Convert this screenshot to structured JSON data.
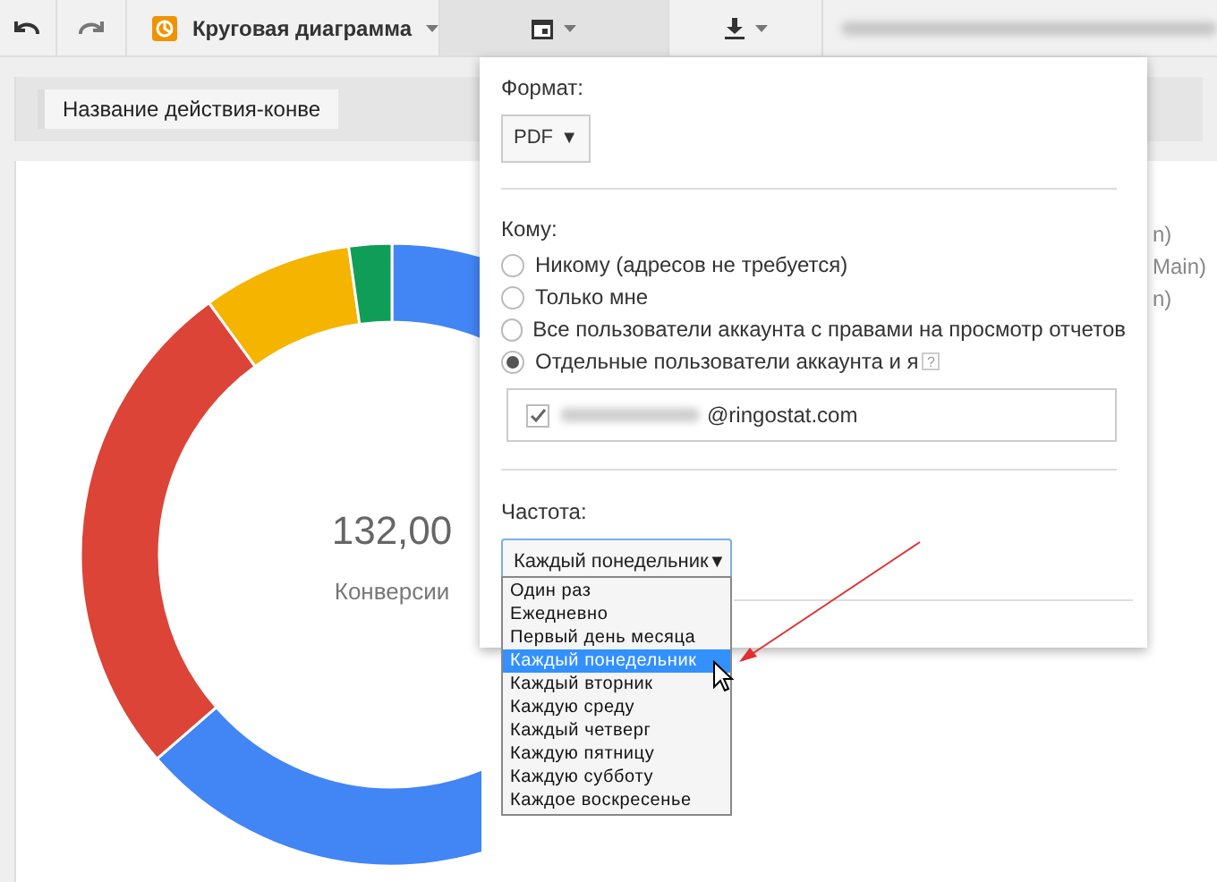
{
  "toolbar": {
    "chart_type": "Круговая диаграмма",
    "buttons": [
      {
        "kind": "schedule",
        "pressed": true
      },
      {
        "kind": "download",
        "pressed": false
      }
    ]
  },
  "dimension_button": "Название действия-конве",
  "chart": {
    "total": "132,00",
    "metric": "Конверсии"
  },
  "legend_fragments": [
    "n)",
    "Main)",
    "n)"
  ],
  "schedule_dialog": {
    "format_label": "Формат:",
    "format": "PDF",
    "format_arrow": "▼",
    "recipients_label": "Кому:",
    "recipients": [
      {
        "label": "Никому (адресов не требуется)",
        "selected": false
      },
      {
        "label": "Только мне",
        "selected": false
      },
      {
        "label": "Все пользователи аккаунта с правами на просмотр отчетов",
        "selected": false
      },
      {
        "label": "Отдельные пользователи аккаунта и я",
        "selected": true,
        "help_mark": "?"
      }
    ],
    "emails": [
      {
        "address": "@ringostat.com",
        "checked": true
      }
    ],
    "frequency_label": "Частота:",
    "frequency": "Каждый понедельник",
    "frequency_arrow": "▼",
    "frequency_options": [
      {
        "label": "Один раз",
        "selected": false
      },
      {
        "label": "Ежедневно",
        "selected": false
      },
      {
        "label": "Первый день месяца",
        "selected": false
      },
      {
        "label": "Каждый понедельник",
        "selected": true
      },
      {
        "label": "Каждый вторник",
        "selected": false
      },
      {
        "label": "Каждую среду",
        "selected": false
      },
      {
        "label": "Каждый четверг",
        "selected": false
      },
      {
        "label": "Каждую пятницу",
        "selected": false
      },
      {
        "label": "Каждую субботу",
        "selected": false
      },
      {
        "label": "Каждое воскресенье",
        "selected": false
      }
    ]
  }
}
